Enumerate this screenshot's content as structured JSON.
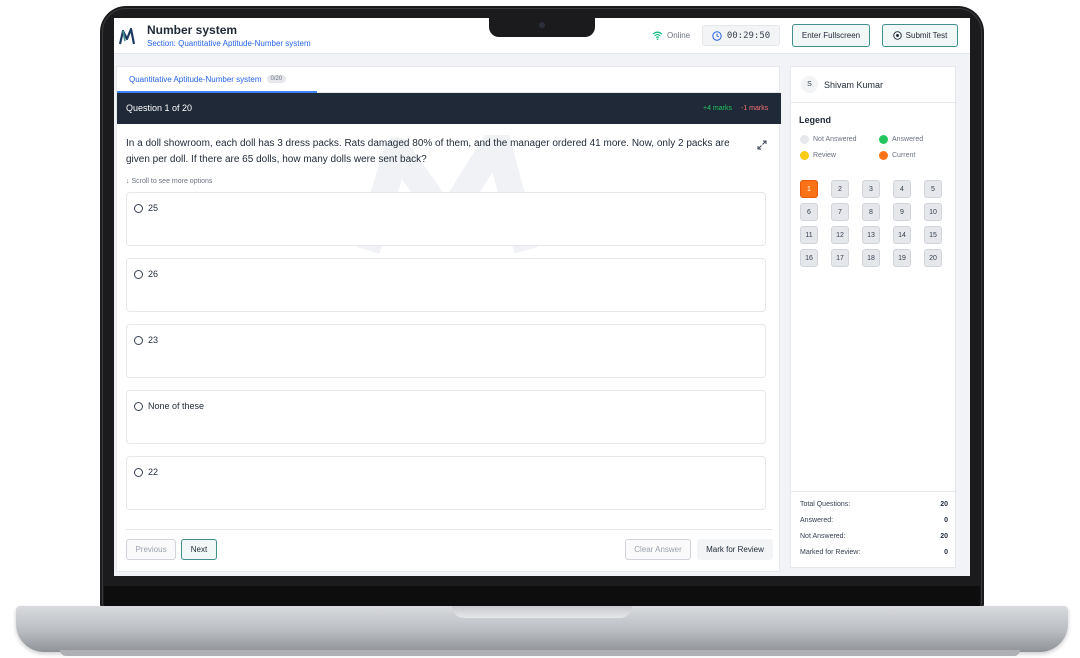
{
  "header": {
    "title": "Number system",
    "subtitle": "Section: Quantitative Aptitude-Number system",
    "status": "Online",
    "timer": "00:29:50",
    "fullscreen_label": "Enter Fullscreen",
    "submit_label": "Submit Test"
  },
  "section_tab": {
    "label": "Quantitative Aptitude-Number system",
    "badge": "0/20"
  },
  "question": {
    "number_label": "Question 1 of 20",
    "positive_marks": "+4 marks",
    "negative_marks": "-1 marks",
    "text": "In a doll showroom, each doll has 3 dress packs. Rats damaged 80% of them, and the manager ordered 41 more. Now, only 2 packs are given per doll. If there are 65 dolls, how many dolls were sent back?",
    "scroll_hint": "↓  Scroll to see more options",
    "options": [
      "25",
      "26",
      "23",
      "None of these",
      "22"
    ]
  },
  "footer": {
    "previous_label": "Previous",
    "next_label": "Next",
    "clear_label": "Clear Answer",
    "review_label": "Mark for Review"
  },
  "sidebar": {
    "avatar_initial": "S",
    "user_name": "Shivam Kumar",
    "legend_title": "Legend",
    "legend": [
      {
        "label": "Not Answered",
        "color": "#e5e7eb"
      },
      {
        "label": "Answered",
        "color": "#22c55e"
      },
      {
        "label": "Review",
        "color": "#facc15"
      },
      {
        "label": "Current",
        "color": "#f97316"
      }
    ],
    "questions": [
      "1",
      "2",
      "3",
      "4",
      "5",
      "6",
      "7",
      "8",
      "9",
      "10",
      "11",
      "12",
      "13",
      "14",
      "15",
      "16",
      "17",
      "18",
      "19",
      "20"
    ],
    "current_question": "1",
    "stats": [
      {
        "label": "Total Questions:",
        "value": "20"
      },
      {
        "label": "Answered:",
        "value": "0"
      },
      {
        "label": "Not Answered:",
        "value": "20"
      },
      {
        "label": "Marked for Review:",
        "value": "0"
      }
    ]
  }
}
